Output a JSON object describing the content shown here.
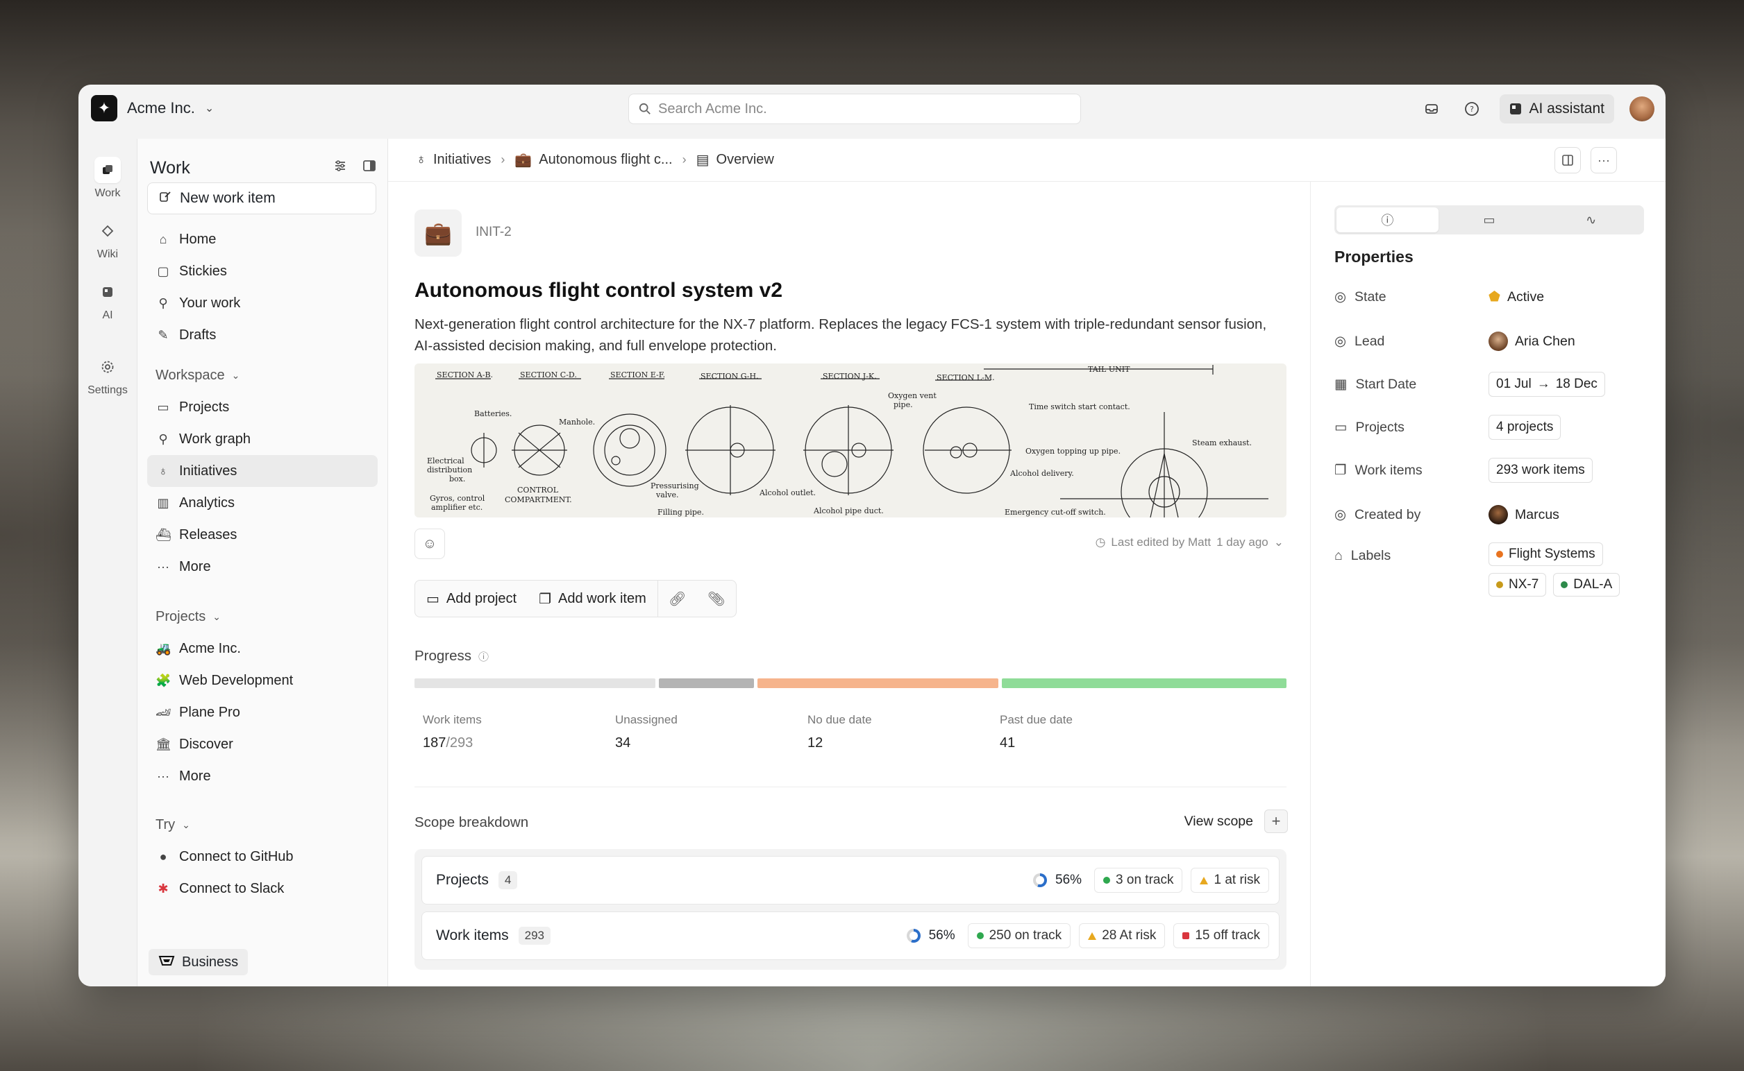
{
  "org": {
    "name": "Acme Inc."
  },
  "search": {
    "placeholder": "Search Acme Inc."
  },
  "topbar": {
    "ai_label": "AI assistant"
  },
  "rail": [
    {
      "label": "Work"
    },
    {
      "label": "Wiki"
    },
    {
      "label": "AI"
    },
    {
      "label": "Settings"
    }
  ],
  "sidebar": {
    "title": "Work",
    "new_item": "New work item",
    "primary": [
      "Home",
      "Stickies",
      "Your work",
      "Drafts"
    ],
    "workspace_label": "Workspace",
    "workspace": [
      "Projects",
      "Work graph",
      "Initiatives",
      "Analytics",
      "Releases",
      "More"
    ],
    "projects_label": "Projects",
    "projects": [
      "Acme Inc.",
      "Web Development",
      "Plane Pro",
      "Discover",
      "More"
    ],
    "try_label": "Try",
    "try": [
      "Connect to GitHub",
      "Connect to Slack"
    ],
    "plan": "Business"
  },
  "breadcrumb": {
    "c1": "Initiatives",
    "c2": "Autonomous flight c...",
    "c3": "Overview"
  },
  "initiative": {
    "id": "INIT-2",
    "title": "Autonomous flight control system v2",
    "description": "Next-generation flight control architecture for the NX-7 platform. Replaces the legacy FCS-1 system with triple-redundant sensor fusion, AI-assisted decision making, and full envelope protection.",
    "edited": "Last edited by Matt",
    "edited_time": "1 day ago"
  },
  "blueprint_labels": {
    "s1": "SECTION A-B.",
    "s2": "SECTION C-D.",
    "s3": "SECTION E-F.",
    "s4": "SECTION G-H.",
    "s5": "SECTION J-K.",
    "s6": "SECTION L-M.",
    "tail": "TAIL UNIT",
    "batteries": "Batteries.",
    "manhole": "Manhole.",
    "elec1": "Electrical",
    "elec2": "distribution",
    "elec3": "box.",
    "gyros1": "Gyros, control",
    "gyros2": "amplifier etc.",
    "ctrl1": "CONTROL",
    "ctrl2": "COMPARTMENT.",
    "press1": "Pressurising",
    "press2": "valve.",
    "filling": "Filling pipe.",
    "alc_out": "Alcohol outlet.",
    "alc_pipe": "Alcohol pipe duct.",
    "oxy1": "Oxygen vent",
    "oxy2": "pipe.",
    "time": "Time switch start contact.",
    "oxy_top": "Oxygen topping up pipe.",
    "alc_del": "Alcohol delivery.",
    "steam": "Steam exhaust.",
    "emergency": "Emergency cut-off switch."
  },
  "actions": {
    "add_project": "Add project",
    "add_work_item": "Add work item"
  },
  "progress": {
    "label": "Progress",
    "segments": [
      {
        "fraction": 0.28,
        "color": "#e4e4e4"
      },
      {
        "fraction": 0.11,
        "color": "#b4b4b4"
      },
      {
        "fraction": 0.28,
        "color": "#f6b48c"
      },
      {
        "fraction": 0.33,
        "color": "#8fdc98"
      }
    ],
    "stats": [
      {
        "label": "Work items",
        "value": "187",
        "total": "/293"
      },
      {
        "label": "Unassigned",
        "value": "34"
      },
      {
        "label": "No due date",
        "value": "12"
      },
      {
        "label": "Past due date",
        "value": "41"
      }
    ]
  },
  "scope": {
    "label": "Scope breakdown",
    "view": "View scope",
    "rows": [
      {
        "name": "Projects",
        "count": "4",
        "percent": "56%",
        "on_track": "3 on track",
        "at_risk": "1 at risk"
      },
      {
        "name": "Work items",
        "count": "293",
        "percent": "56%",
        "on_track": "250 on track",
        "at_risk": "28 At risk",
        "off_track": "15 off track"
      }
    ]
  },
  "properties": {
    "title": "Properties",
    "state_label": "State",
    "state": "Active",
    "lead_label": "Lead",
    "lead": "Aria Chen",
    "date_label": "Start Date",
    "start": "01 Jul",
    "end": "18 Dec",
    "projects_label": "Projects",
    "projects": "4 projects",
    "work_label": "Work items",
    "work": "293 work items",
    "created_label": "Created by",
    "created": "Marcus",
    "labels_label": "Labels",
    "labels": [
      {
        "name": "Flight Systems",
        "color": "#e8731f"
      },
      {
        "name": "NX-7",
        "color": "#c79a1a"
      },
      {
        "name": "DAL-A",
        "color": "#2d8a4a"
      }
    ]
  },
  "colors": {
    "on_track": "#2fa84f",
    "at_risk": "#e7a81f",
    "off_track": "#d9363e",
    "state": "#e7a81f"
  }
}
